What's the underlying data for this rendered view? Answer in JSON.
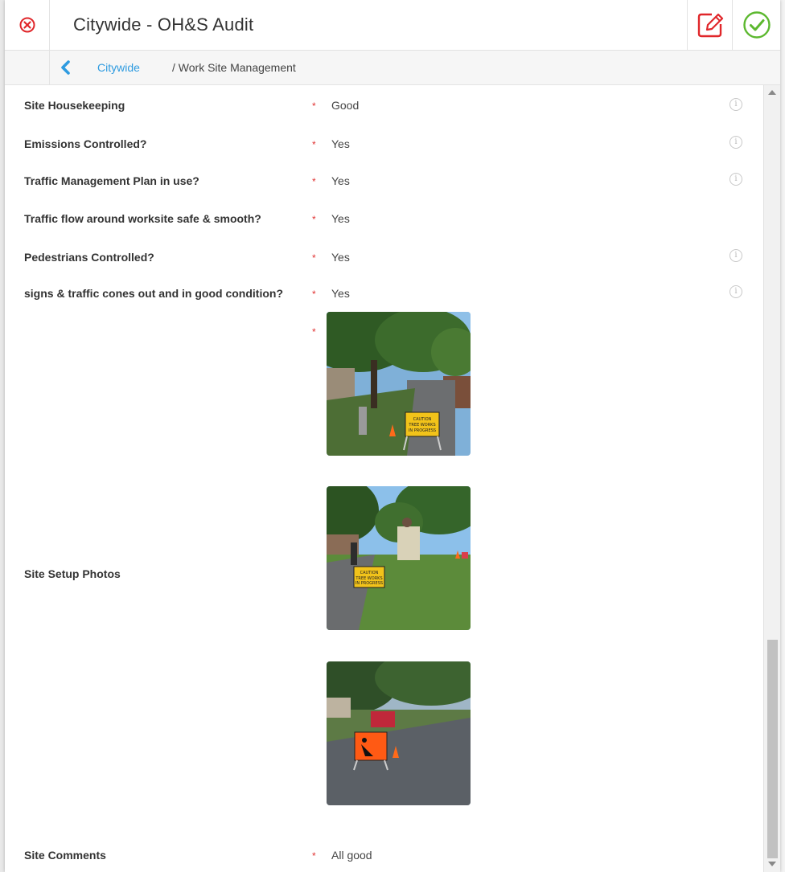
{
  "header": {
    "title": "Citywide - OH&S Audit",
    "close_icon": "close-circle-icon",
    "edit_icon": "edit-icon",
    "confirm_icon": "check-circle-icon"
  },
  "breadcrumb": {
    "back_icon": "chevron-left-icon",
    "link": "Citywide",
    "current": "/ Work Site Management"
  },
  "fields": [
    {
      "label": "Site Housekeeping",
      "required": "*",
      "value": "Good",
      "info": "i"
    },
    {
      "label": "Emissions Controlled?",
      "required": "*",
      "value": "Yes",
      "info": "i"
    },
    {
      "label": "Traffic Management Plan in use?",
      "required": "*",
      "value": "Yes",
      "info": "i"
    },
    {
      "label": "Traffic flow around worksite safe & smooth?",
      "required": "*",
      "value": "Yes"
    },
    {
      "label": "Pedestrians Controlled?",
      "required": "*",
      "value": "Yes",
      "info": "i"
    },
    {
      "label": "signs & traffic cones out and in good condition?",
      "required": "*",
      "value": "Yes",
      "info": "i"
    }
  ],
  "photos_field": {
    "label": "Site Setup Photos",
    "required": "*",
    "photo_signs": [
      "CAUTION TREE WORKS IN PROGRESS",
      "CAUTION TREE WORKS IN PROGRESS",
      ""
    ]
  },
  "comments_field": {
    "label": "Site Comments",
    "required": "*",
    "value": "All good"
  },
  "colors": {
    "close_red": "#e0262a",
    "edit_red": "#e0262a",
    "confirm_green": "#5cb82f",
    "link_blue": "#2e9be0",
    "required_red": "#e03030"
  }
}
